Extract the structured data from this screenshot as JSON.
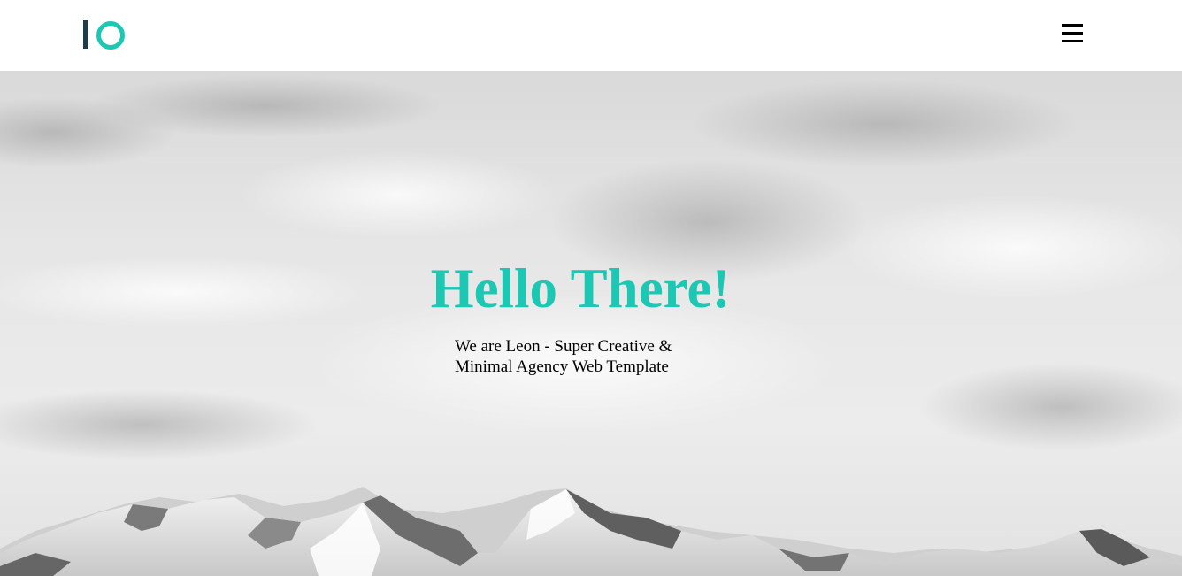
{
  "header": {
    "logo": {
      "letter_bar": "I",
      "letter_ring": "O",
      "bar_color": "#1e3d4a",
      "ring_color": "#1cc7b4"
    },
    "menu_icon": "hamburger-menu-icon"
  },
  "hero": {
    "title": "Hello There!",
    "title_color": "#1cc7b4",
    "subtitle_line1": "We are Leon - Super Creative &",
    "subtitle_line2": "Minimal Agency Web Template",
    "background": "grayscale sky with snowy mountains"
  }
}
